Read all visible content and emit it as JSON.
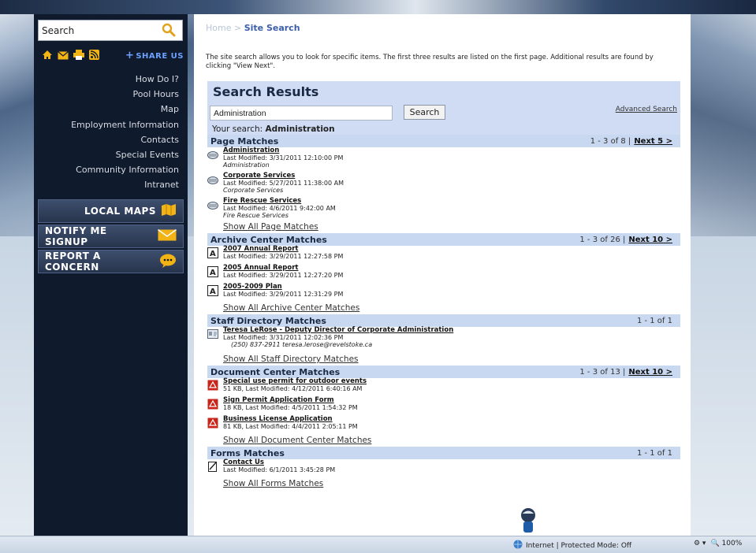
{
  "sidebar": {
    "search_value": "Search",
    "share_label": "SHARE US",
    "nav": [
      "How Do I?",
      "Pool Hours",
      "Map",
      "Employment Information",
      "Contacts",
      "Special Events",
      "Community Information",
      "Intranet"
    ],
    "buttons": {
      "local_maps": "LOCAL MAPS",
      "notify": "NOTIFY ME SIGNUP",
      "report": "REPORT A CONCERN"
    }
  },
  "breadcrumb": {
    "home": "Home",
    "sep": ">",
    "current": "Site Search"
  },
  "intro": "The site search allows you to look for specific items. The first three results are listed on the first page. Additional results are found by clicking \"View Next\".",
  "results": {
    "title": "Search Results",
    "query": "Administration",
    "search_button": "Search",
    "advanced": "Advanced Search",
    "your_search_label": "Your search:",
    "your_search_value": "Administration"
  },
  "sections": {
    "page": {
      "title": "Page Matches",
      "count": "1 - 3 of 8 |",
      "next": "Next 5 >",
      "items": [
        {
          "title": "Administration",
          "meta": "Last Modified: 3/31/2011 12:10:00 PM",
          "sub": "Administration"
        },
        {
          "title": "Corporate Services",
          "meta": "Last Modified: 5/27/2011 11:38:00 AM",
          "sub": "Corporate Services"
        },
        {
          "title": "Fire Rescue Services",
          "meta": "Last Modified: 4/6/2011 9:42:00 AM",
          "sub": "Fire Rescue Services"
        }
      ],
      "show_all": "Show All Page Matches"
    },
    "archive": {
      "title": "Archive Center Matches",
      "count": "1 - 3 of 26 |",
      "next": "Next 10 >",
      "items": [
        {
          "title": "2007 Annual Report",
          "meta": "Last Modified: 3/29/2011 12:27:58 PM"
        },
        {
          "title": "2005 Annual Report",
          "meta": "Last Modified: 3/29/2011 12:27:20 PM"
        },
        {
          "title": "2005-2009 Plan",
          "meta": "Last Modified: 3/29/2011 12:31:29 PM"
        }
      ],
      "show_all": "Show All Archive Center Matches"
    },
    "staff": {
      "title": "Staff Directory Matches",
      "count": "1 - 1 of 1",
      "items": [
        {
          "title": "Teresa LeRose  -  Deputy Director of Corporate Administration",
          "meta": "Last Modified: 3/31/2011 12:02:36 PM",
          "sub": "(250) 837-2911    teresa.lerose@revelstoke.ca"
        }
      ],
      "show_all": "Show All Staff Directory Matches"
    },
    "docs": {
      "title": "Document Center Matches",
      "count": "1 - 3 of 13 |",
      "next": "Next 10 >",
      "items": [
        {
          "title": "Special use permit for outdoor events",
          "meta": "51 KB, Last Modified: 4/12/2011 6:40:16 AM"
        },
        {
          "title": "Sign Permit Application Form",
          "meta": "18 KB, Last Modified: 4/5/2011 1:54:32 PM"
        },
        {
          "title": "Business License Application",
          "meta": "81 KB, Last Modified: 4/4/2011 2:05:11 PM"
        }
      ],
      "show_all": "Show All Document Center Matches"
    },
    "forms": {
      "title": "Forms Matches",
      "count": "1 - 1 of 1",
      "items": [
        {
          "title": "Contact Us",
          "meta": "Last Modified: 6/1/2011 3:45:28 PM"
        }
      ],
      "show_all": "Show All Forms Matches"
    }
  },
  "status_bar": {
    "zone": "Internet | Protected Mode: Off",
    "zoom": "100%"
  },
  "colors": {
    "sidebar": "#0f1a2c",
    "section_bar": "#c9d8f1",
    "link": "#3b5ea8"
  }
}
